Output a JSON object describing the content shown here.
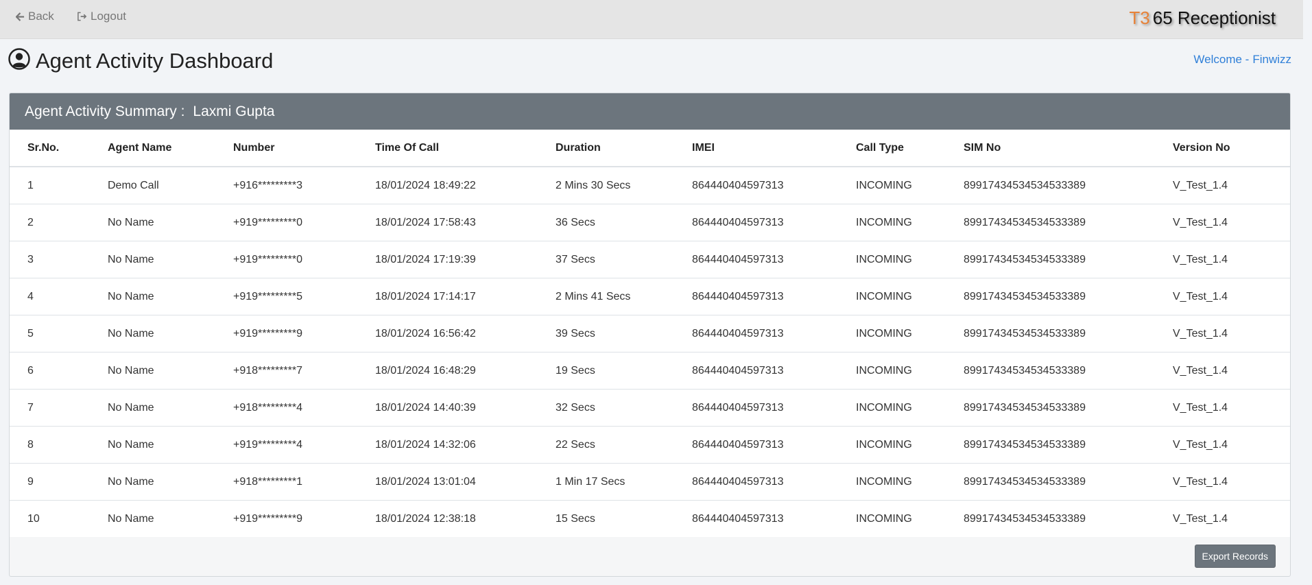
{
  "nav": {
    "back_label": "Back",
    "logout_label": "Logout"
  },
  "brand": {
    "mark": "T3",
    "name": "65 Receptionist"
  },
  "page": {
    "title": "Agent Activity Dashboard",
    "welcome_prefix": "Welcome -",
    "welcome_user": "Finwizz"
  },
  "summary": {
    "header_label": "Agent Activity Summary :",
    "agent_name": "Laxmi Gupta"
  },
  "table": {
    "columns": [
      "Sr.No.",
      "Agent Name",
      "Number",
      "Time Of Call",
      "Duration",
      "IMEI",
      "Call Type",
      "SIM No",
      "Version No"
    ],
    "rows": [
      [
        "1",
        "Demo Call",
        "+916*********3",
        "18/01/2024 18:49:22",
        "2 Mins 30 Secs",
        "864440404597313",
        "INCOMING",
        "89917434534534533389",
        "V_Test_1.4"
      ],
      [
        "2",
        "No Name",
        "+919*********0",
        "18/01/2024 17:58:43",
        "36 Secs",
        "864440404597313",
        "INCOMING",
        "89917434534534533389",
        "V_Test_1.4"
      ],
      [
        "3",
        "No Name",
        "+919*********0",
        "18/01/2024 17:19:39",
        "37 Secs",
        "864440404597313",
        "INCOMING",
        "89917434534534533389",
        "V_Test_1.4"
      ],
      [
        "4",
        "No Name",
        "+919*********5",
        "18/01/2024 17:14:17",
        "2 Mins 41 Secs",
        "864440404597313",
        "INCOMING",
        "89917434534534533389",
        "V_Test_1.4"
      ],
      [
        "5",
        "No Name",
        "+919*********9",
        "18/01/2024 16:56:42",
        "39 Secs",
        "864440404597313",
        "INCOMING",
        "89917434534534533389",
        "V_Test_1.4"
      ],
      [
        "6",
        "No Name",
        "+918*********7",
        "18/01/2024 16:48:29",
        "19 Secs",
        "864440404597313",
        "INCOMING",
        "89917434534534533389",
        "V_Test_1.4"
      ],
      [
        "7",
        "No Name",
        "+918*********4",
        "18/01/2024 14:40:39",
        "32 Secs",
        "864440404597313",
        "INCOMING",
        "89917434534534533389",
        "V_Test_1.4"
      ],
      [
        "8",
        "No Name",
        "+919*********4",
        "18/01/2024 14:32:06",
        "22 Secs",
        "864440404597313",
        "INCOMING",
        "89917434534534533389",
        "V_Test_1.4"
      ],
      [
        "9",
        "No Name",
        "+918*********1",
        "18/01/2024 13:01:04",
        "1 Min 17 Secs",
        "864440404597313",
        "INCOMING",
        "89917434534534533389",
        "V_Test_1.4"
      ],
      [
        "10",
        "No Name",
        "+919*********9",
        "18/01/2024 12:38:18",
        "15 Secs",
        "864440404597313",
        "INCOMING",
        "89917434534534533389",
        "V_Test_1.4"
      ]
    ]
  },
  "actions": {
    "export_label": "Export Records"
  },
  "colors": {
    "brand_accent": "#e8711a",
    "link": "#2f7fd8",
    "card_header": "#6c757d"
  },
  "icons": {
    "back": "arrow-left-icon",
    "logout": "sign-out-icon",
    "title": "user-circle-icon"
  }
}
